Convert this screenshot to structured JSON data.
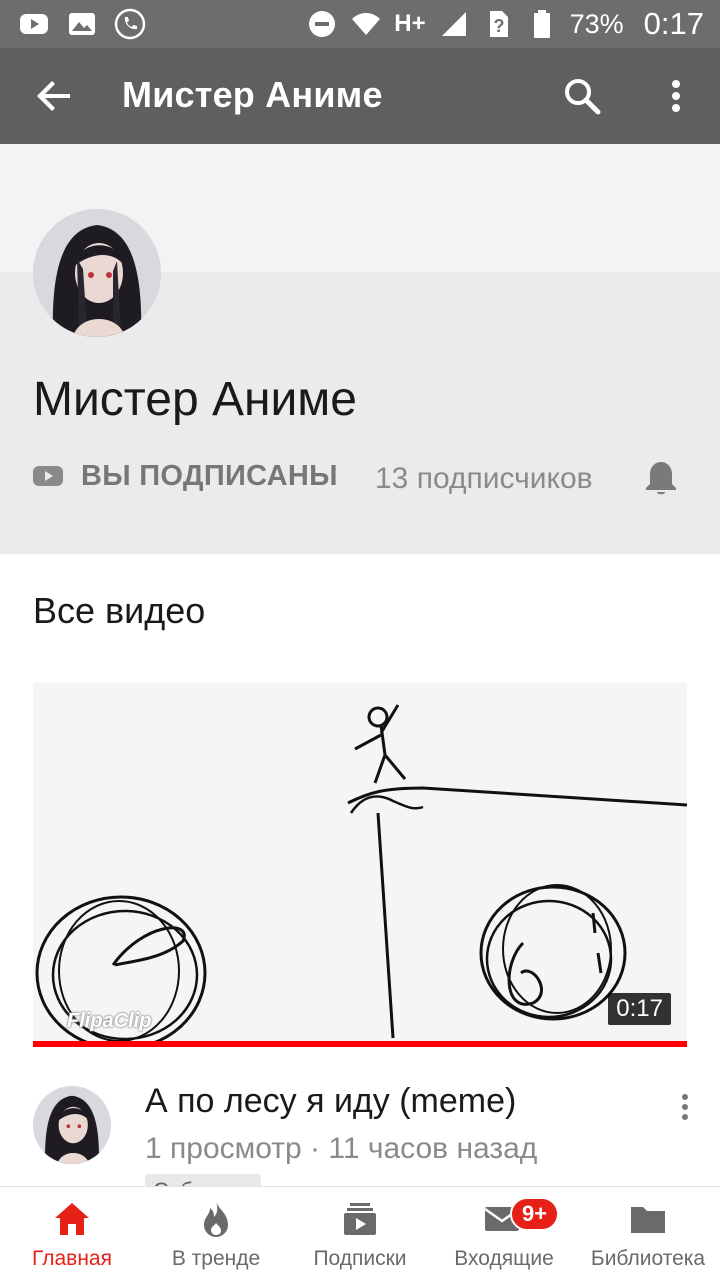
{
  "status_bar": {
    "battery": "73%",
    "time": "0:17",
    "network": "H+",
    "icons": [
      "youtube-icon",
      "image-icon",
      "phone-icon",
      "dnd-icon",
      "wifi-icon",
      "signal-icon",
      "sim-unknown-icon",
      "battery-icon"
    ]
  },
  "app_bar": {
    "title": "Мистер Аниме",
    "icons": [
      "back-arrow-icon",
      "search-icon",
      "more-vert-icon"
    ]
  },
  "channel": {
    "name": "Мистер Аниме",
    "subscribe_label": "ВЫ ПОДПИСАНЫ",
    "subscriber_count": "13 подписчиков",
    "icons": [
      "youtube-icon",
      "bell-icon"
    ]
  },
  "section": {
    "title": "Все видео"
  },
  "video": {
    "duration": "0:17",
    "watermark": "FlipaClip",
    "title": "А по лесу я иду (meme)",
    "meta": "1 просмотр · 11 часов назад",
    "tag": "Субтитры",
    "watched_fraction": 1.0
  },
  "bottom_nav": {
    "items": [
      {
        "label": "Главная",
        "icon": "home-icon",
        "active": true
      },
      {
        "label": "В тренде",
        "icon": "flame-icon",
        "active": false
      },
      {
        "label": "Подписки",
        "icon": "subscriptions-icon",
        "active": false
      },
      {
        "label": "Входящие",
        "icon": "mail-icon",
        "active": false,
        "badge": "9+"
      },
      {
        "label": "Библиотека",
        "icon": "folder-icon",
        "active": false
      }
    ]
  },
  "colors": {
    "app_bar": "#5f5f5f",
    "status_bar": "#6d6d6d",
    "accent_red": "#e62117"
  }
}
